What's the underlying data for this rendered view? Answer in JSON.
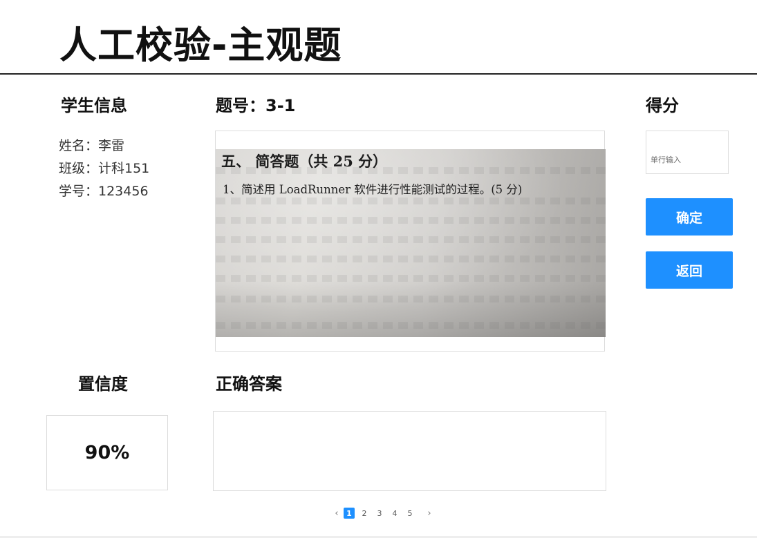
{
  "page": {
    "title": "人工校验-主观题"
  },
  "student": {
    "heading": "学生信息",
    "name": "姓名：李雷",
    "class": "班级：计科151",
    "id": "学号：123456"
  },
  "question": {
    "heading": "题号：3-1",
    "image_text": {
      "section": "五、  简答题（共 25 分）",
      "line": "1、简述用 LoadRunner 软件进行性能测试的过程。(5 分)"
    }
  },
  "score": {
    "heading": "得分",
    "placeholder": "单行输入",
    "value": ""
  },
  "actions": {
    "confirm": "确定",
    "back": "返回"
  },
  "confidence": {
    "heading": "置信度",
    "value": "90%"
  },
  "answer": {
    "heading": "正确答案",
    "text": ""
  },
  "pagination": {
    "prev": "‹",
    "next": "›",
    "pages": [
      "1",
      "2",
      "3",
      "4",
      "5"
    ],
    "current": "1"
  },
  "colors": {
    "accent": "#1e90ff",
    "border": "#dcdcdc",
    "title": "#111111"
  }
}
